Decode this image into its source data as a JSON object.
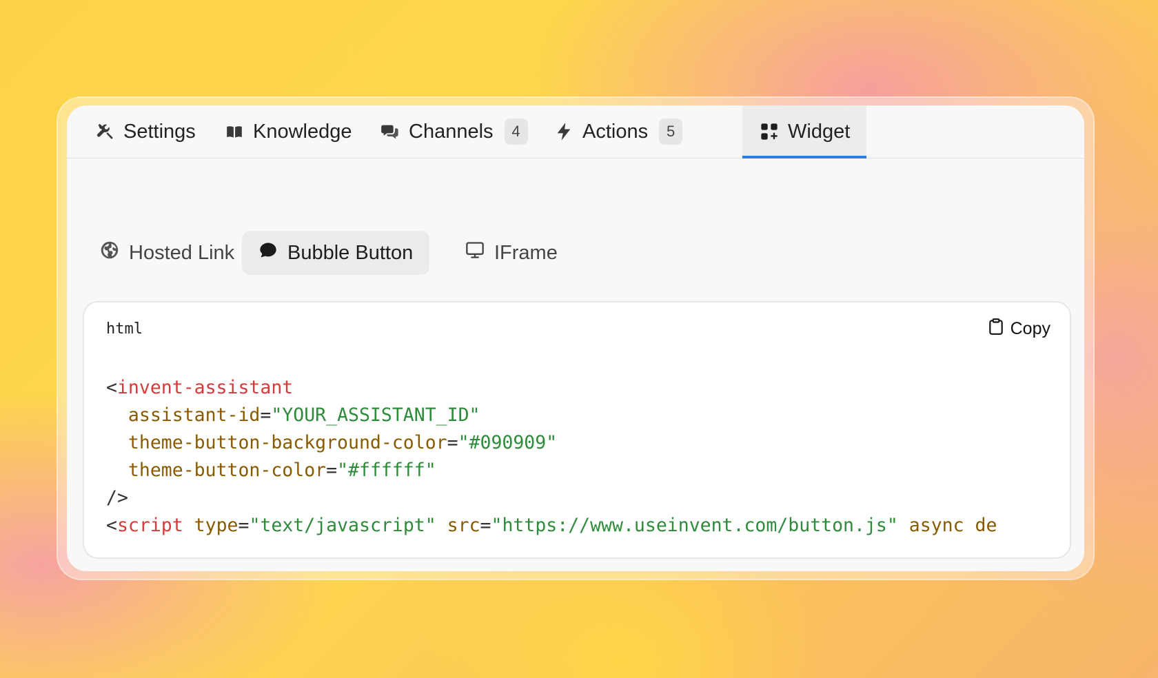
{
  "tabs": [
    {
      "label": "Settings",
      "icon": "wrench-screwdriver-icon"
    },
    {
      "label": "Knowledge",
      "icon": "book-icon"
    },
    {
      "label": "Channels",
      "icon": "chat-bubbles-icon",
      "count": "4"
    },
    {
      "label": "Actions",
      "icon": "bolt-icon",
      "count": "5"
    },
    {
      "label": "Widget",
      "icon": "squares-plus-icon",
      "active": true
    }
  ],
  "subtabs": [
    {
      "label": "Hosted Link",
      "icon": "globe-icon"
    },
    {
      "label": "Bubble Button",
      "icon": "chat-bubble-icon",
      "active": true
    },
    {
      "label": "IFrame",
      "icon": "monitor-icon"
    }
  ],
  "code": {
    "language": "html",
    "copy_label": "Copy",
    "tokens": {
      "lt": "<",
      "tag1": "invent-assistant",
      "attr1": "assistant-id",
      "eq": "=",
      "val1": "\"YOUR_ASSISTANT_ID\"",
      "attr2": "theme-button-background-color",
      "val2": "\"#090909\"",
      "attr3": "theme-button-color",
      "val3": "\"#ffffff\"",
      "selfclose": "/>",
      "tag2": "script",
      "attr4": "type",
      "val4": "\"text/javascript\"",
      "attr5": "src",
      "val5": "\"https://www.useinvent.com/button.js\"",
      "attr6": "async de"
    }
  },
  "colors": {
    "active_tab_underline": "#2a7be4",
    "code_tag": "#d73a3a",
    "code_attr": "#8a5a00",
    "code_string": "#2e8b3a"
  }
}
